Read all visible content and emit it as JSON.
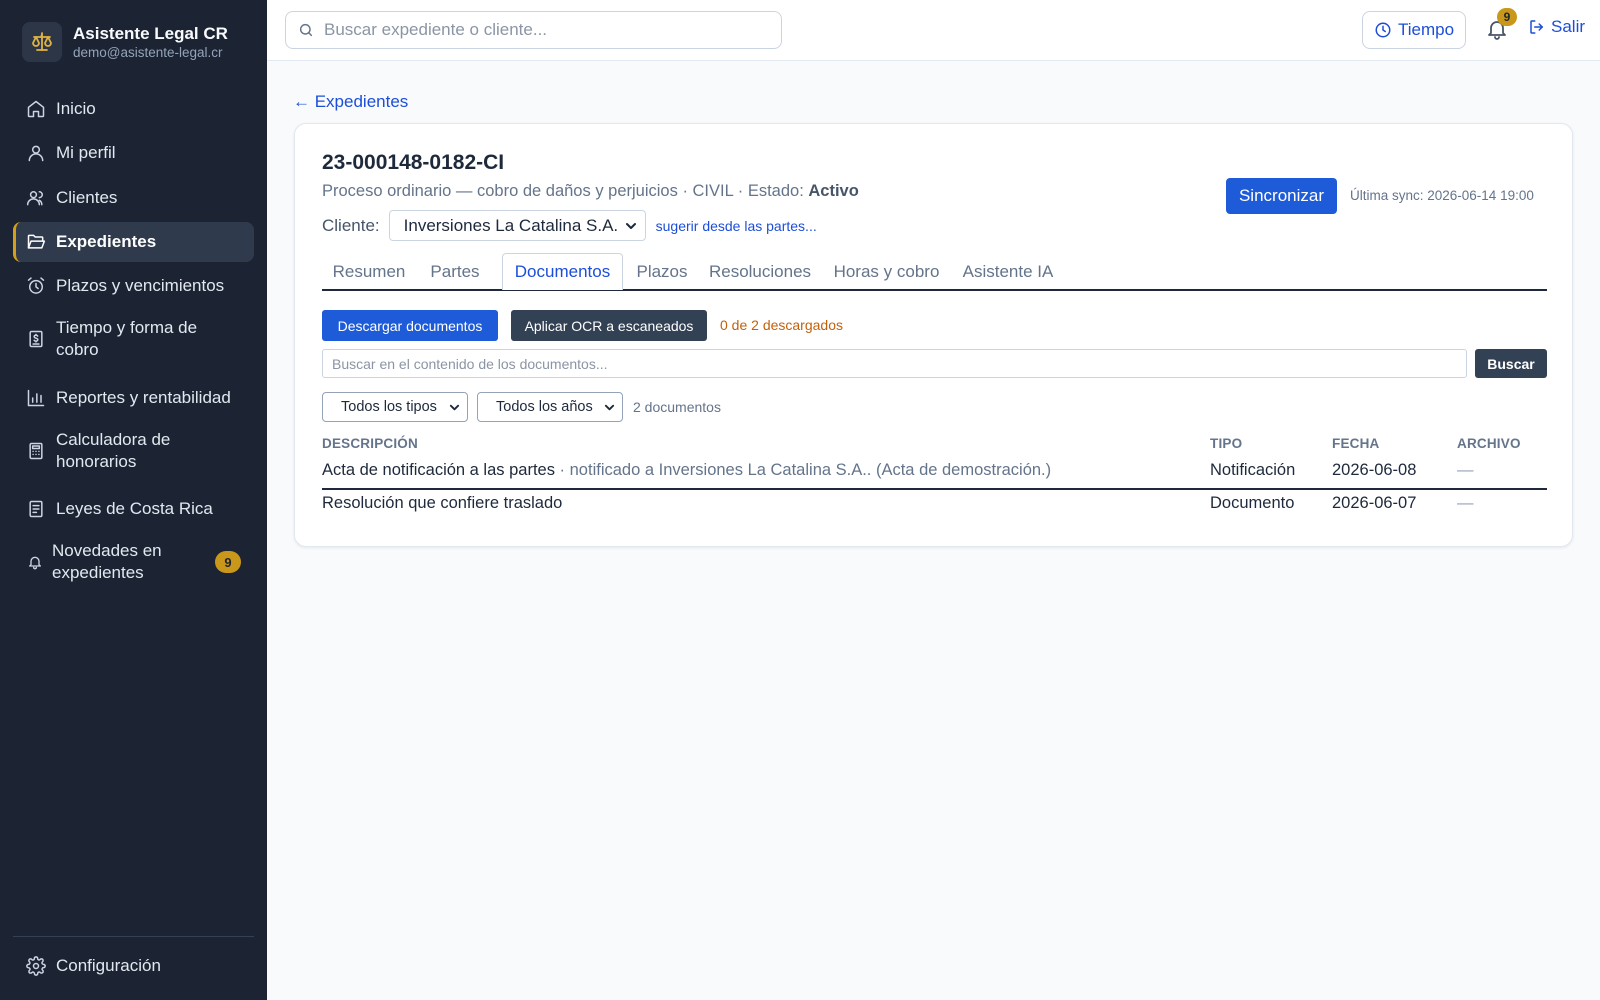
{
  "app": {
    "name": "Asistente Legal CR",
    "email": "demo@asistente-legal.cr"
  },
  "sidebar": {
    "items": [
      {
        "label": "Inicio",
        "icon": "home-icon"
      },
      {
        "label": "Mi perfil",
        "icon": "user-icon"
      },
      {
        "label": "Clientes",
        "icon": "users-icon"
      },
      {
        "label": "Expedientes",
        "icon": "folder-open-icon",
        "active": true
      },
      {
        "label": "Plazos y vencimientos",
        "icon": "alarm-clock-icon"
      },
      {
        "label": "Tiempo y forma de cobro",
        "icon": "receipt-icon"
      },
      {
        "label": "Reportes y rentabilidad",
        "icon": "bar-chart-icon"
      },
      {
        "label": "Calculadora de honorarios",
        "icon": "calculator-icon"
      },
      {
        "label": "Leyes de Costa Rica",
        "icon": "book-icon"
      },
      {
        "label": "Novedades en expedientes",
        "icon": "bell-icon",
        "badge": "9"
      }
    ],
    "settings_label": "Configuración"
  },
  "topbar": {
    "search_placeholder": "Buscar expediente o cliente...",
    "tiempo_label": "Tiempo",
    "notifications_count": "9",
    "salir_label": "Salir"
  },
  "main": {
    "back_label": "← Expedientes",
    "case": {
      "id": "23-000148-0182-CI",
      "description": "Proceso ordinario — cobro de daños y perjuicios · CIVIL · Estado: ",
      "status": "Activo",
      "client_label": "Cliente:",
      "client_value": "Inversiones La Catalina S.A.",
      "suggest_label": "sugerir desde las partes...",
      "sync_label": "Sincronizar",
      "last_sync": "Última sync: 2026-06-14 19:00"
    },
    "tabs": [
      "Resumen",
      "Partes",
      "Documentos",
      "Plazos",
      "Resoluciones",
      "Horas y cobro",
      "Asistente IA"
    ],
    "active_tab": "Documentos",
    "documents": {
      "download_label": "Descargar documentos",
      "ocr_label": "Aplicar OCR a escaneados",
      "download_status": "0 de 2 descargados",
      "search_placeholder": "Buscar en el contenido de los documentos...",
      "search_button": "Buscar",
      "type_filter": "Todos los tipos",
      "year_filter": "Todos los años",
      "count_label": "2 documentos",
      "columns": [
        "DESCRIPCIÓN",
        "TIPO",
        "FECHA",
        "ARCHIVO"
      ],
      "rows": [
        {
          "description": "Acta de notificación a las partes",
          "note": " · notificado a Inversiones La Catalina S.A.. (Acta de demostración.)",
          "type": "Notificación",
          "date": "2026-06-08",
          "file": "—"
        },
        {
          "description": "Resolución que confiere traslado",
          "note": "",
          "type": "Documento",
          "date": "2026-06-07",
          "file": "—"
        }
      ]
    }
  },
  "colors": {
    "sidebar_bg": "#1c2434",
    "accent_blue": "#1d5bd8",
    "badge_gold": "#c9971a",
    "status_orange": "#c2610c"
  }
}
